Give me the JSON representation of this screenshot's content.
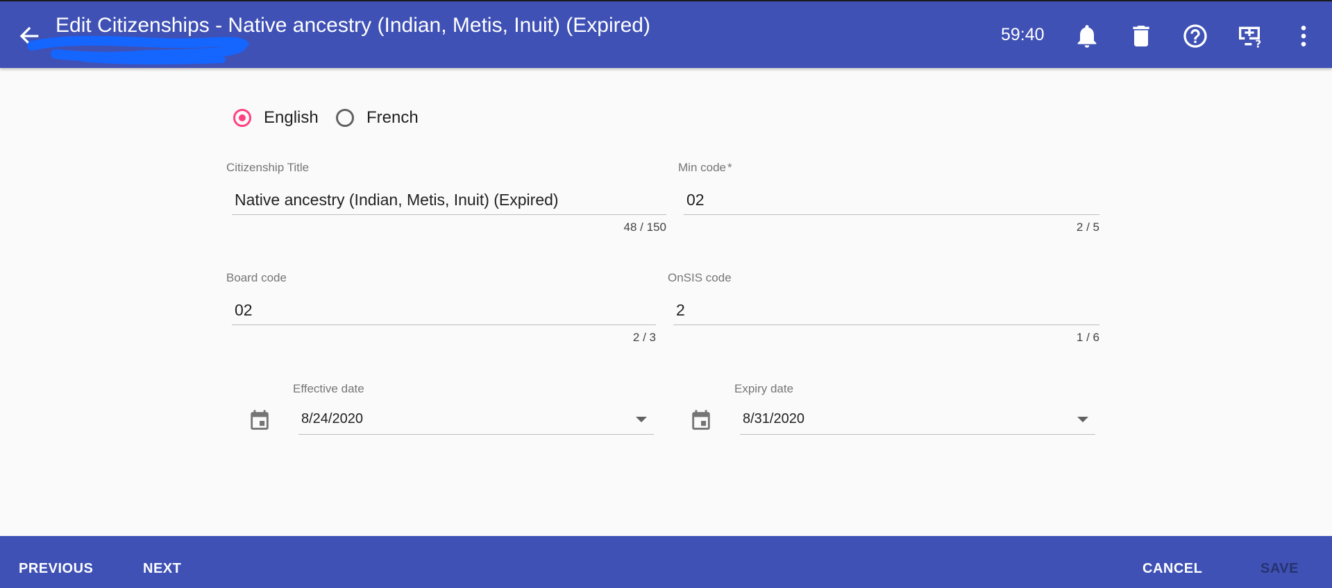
{
  "header": {
    "title": "Edit Citizenships - Native ancestry (Indian, Metis, Inuit) (Expired)",
    "timer": "59:40"
  },
  "icons": {
    "back": "arrow-left",
    "notifications": "bell",
    "delete": "trash",
    "help": "question-circle",
    "screen": "monitor-help",
    "more": "dots-vertical",
    "calendar": "calendar"
  },
  "language": {
    "options": [
      "English",
      "French"
    ],
    "selected": "English"
  },
  "form": {
    "citizenship_title": {
      "label": "Citizenship Title",
      "value": "Native ancestry (Indian, Metis, Inuit) (Expired)",
      "counter": "48 / 150"
    },
    "min_code": {
      "label": "Min code",
      "required_mark": "*",
      "value": "02",
      "counter": "2 / 5"
    },
    "board_code": {
      "label": "Board code",
      "value": "02",
      "counter": "2 / 3"
    },
    "onsis_code": {
      "label": "OnSIS code",
      "value": "2",
      "counter": "1 / 6"
    },
    "effective_date": {
      "label": "Effective date",
      "value": "8/24/2020"
    },
    "expiry_date": {
      "label": "Expiry date",
      "value": "8/31/2020"
    }
  },
  "footer": {
    "previous": "PREVIOUS",
    "next": "NEXT",
    "cancel": "CANCEL",
    "save": "SAVE"
  },
  "colors": {
    "primary": "#3f51b5",
    "accent": "#ff4081",
    "redaction": "#1565ff"
  }
}
